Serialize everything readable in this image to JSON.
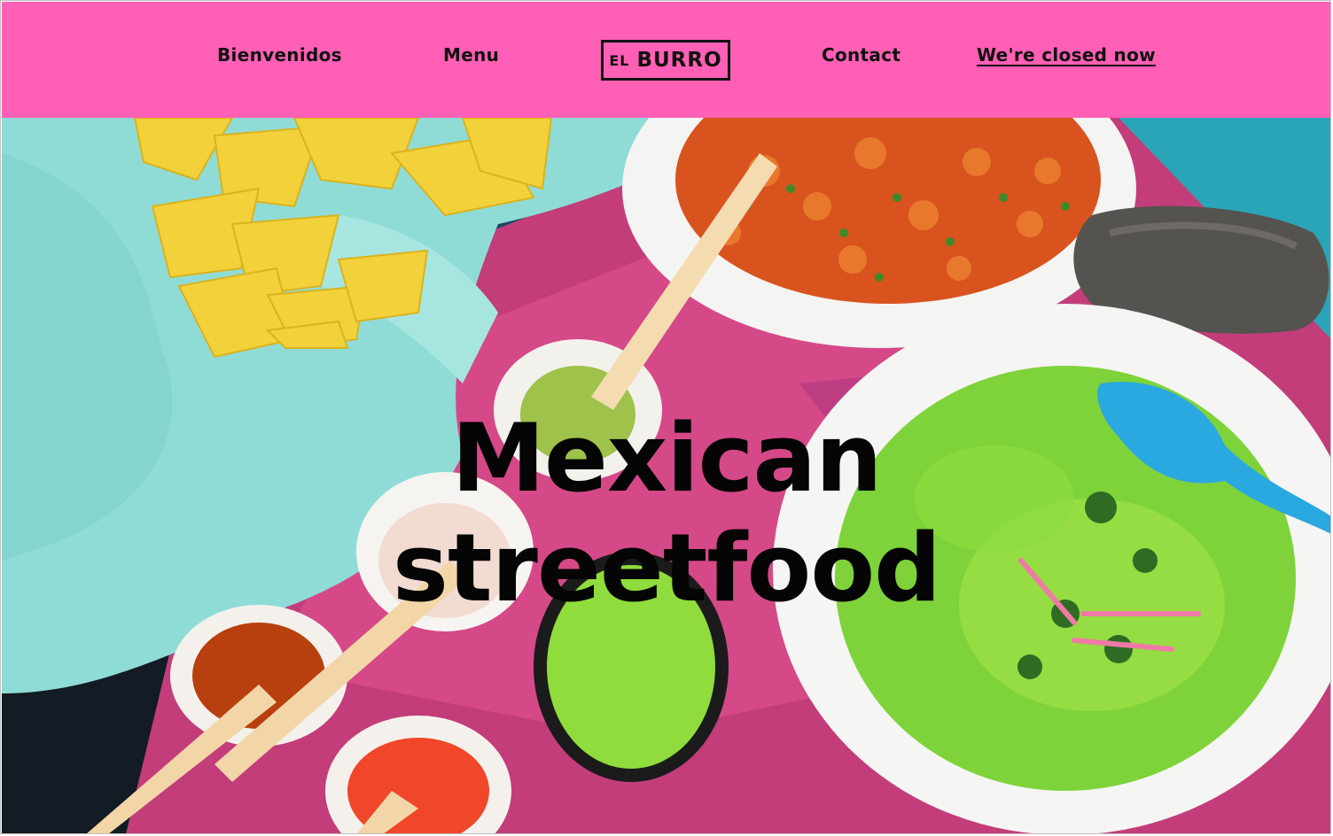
{
  "nav": {
    "bienvenidos": "Bienvenidos",
    "menu": "Menu",
    "logo": "BURRO",
    "logo_prefix": "EL",
    "contact": "Contact",
    "status": "We're closed now"
  },
  "hero": {
    "line1": "Mexican",
    "line2": "streetfood",
    "image": "mexican-food-table-photo"
  },
  "colors": {
    "header_bg": "#ff5fb4",
    "text": "#111111"
  }
}
